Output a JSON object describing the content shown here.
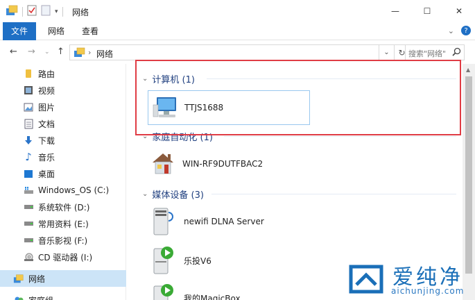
{
  "window": {
    "title": "网络",
    "buttons": {
      "minimize": "—",
      "maximize": "☐",
      "close": "✕"
    }
  },
  "ribbon": {
    "tabs": [
      "文件",
      "网络",
      "查看"
    ],
    "help": "?"
  },
  "address": {
    "path": "网络",
    "search_placeholder": "搜索\"网络\""
  },
  "sidebar": {
    "items": [
      {
        "label": "路由",
        "icon": "router-icon"
      },
      {
        "label": "视频",
        "icon": "video-icon"
      },
      {
        "label": "图片",
        "icon": "picture-icon"
      },
      {
        "label": "文档",
        "icon": "document-icon"
      },
      {
        "label": "下载",
        "icon": "download-icon"
      },
      {
        "label": "音乐",
        "icon": "music-icon"
      },
      {
        "label": "桌面",
        "icon": "desktop-icon"
      },
      {
        "label": "Windows_OS (C:)",
        "icon": "drive-icon"
      },
      {
        "label": "系统软件 (D:)",
        "icon": "drive-icon"
      },
      {
        "label": "常用资料 (E:)",
        "icon": "drive-icon"
      },
      {
        "label": "音乐影视 (F:)",
        "icon": "drive-icon"
      },
      {
        "label": "CD 驱动器 (I:)",
        "icon": "cd-drive-icon"
      },
      {
        "label": "网络",
        "icon": "network-icon",
        "selected": true
      },
      {
        "label": "家庭组",
        "icon": "homegroup-icon"
      }
    ]
  },
  "groups": [
    {
      "header": "计算机 (1)",
      "items": [
        {
          "label": "TTJS1688",
          "icon": "computer-icon"
        }
      ]
    },
    {
      "header": "家庭自动化 (1)",
      "items": [
        {
          "label": "WIN-RF9DUTFBAC2",
          "icon": "house-icon"
        }
      ]
    },
    {
      "header": "媒体设备 (3)",
      "items": [
        {
          "label": "newifi DLNA Server",
          "icon": "media-server-icon"
        },
        {
          "label": "乐投V6",
          "icon": "media-device-icon"
        },
        {
          "label": "我的MagicBox",
          "icon": "media-device-icon"
        }
      ]
    }
  ],
  "watermark": {
    "brand": "爱纯净",
    "url": "aichunjing.com"
  },
  "colors": {
    "accent": "#1e6fc5",
    "highlight_box": "#e03c45",
    "selected_bg": "#cce4f7",
    "group_header": "#1f3f7f"
  }
}
